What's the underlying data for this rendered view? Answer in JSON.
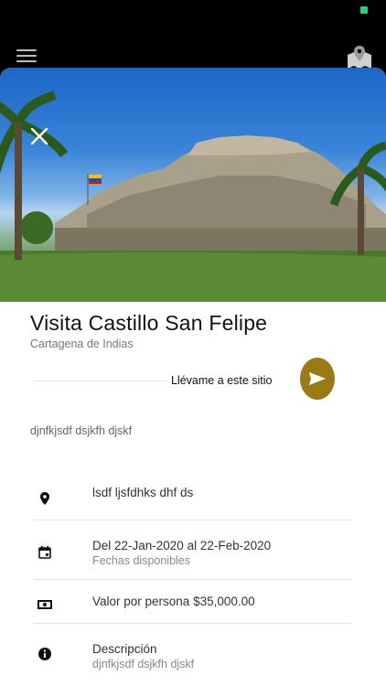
{
  "header": {
    "menu_icon": "hamburger-icon",
    "map_icon": "map-pin-icon"
  },
  "hero": {
    "close_icon": "close-icon"
  },
  "place": {
    "title": "Visita Castillo San Felipe",
    "city": "Cartagena de Indias"
  },
  "navigate": {
    "label": "Llévame a este sitio",
    "icon": "send-icon",
    "button_color": "#9a7a16"
  },
  "summary": "djnfkjsdf dsjkfh djskf",
  "details": {
    "location": {
      "icon": "location-pin-icon",
      "text": "lsdf ljsfdhks dhf ds"
    },
    "dates": {
      "icon": "calendar-icon",
      "text": "Del 22-Jan-2020 al 22-Feb-2020",
      "caption": "Fechas disponibles"
    },
    "price": {
      "icon": "money-icon",
      "text": "Valor por persona $35,000.00"
    },
    "description": {
      "icon": "info-icon",
      "title": "Descripción",
      "text": "djnfkjsdf dsjkfh djskf"
    }
  }
}
